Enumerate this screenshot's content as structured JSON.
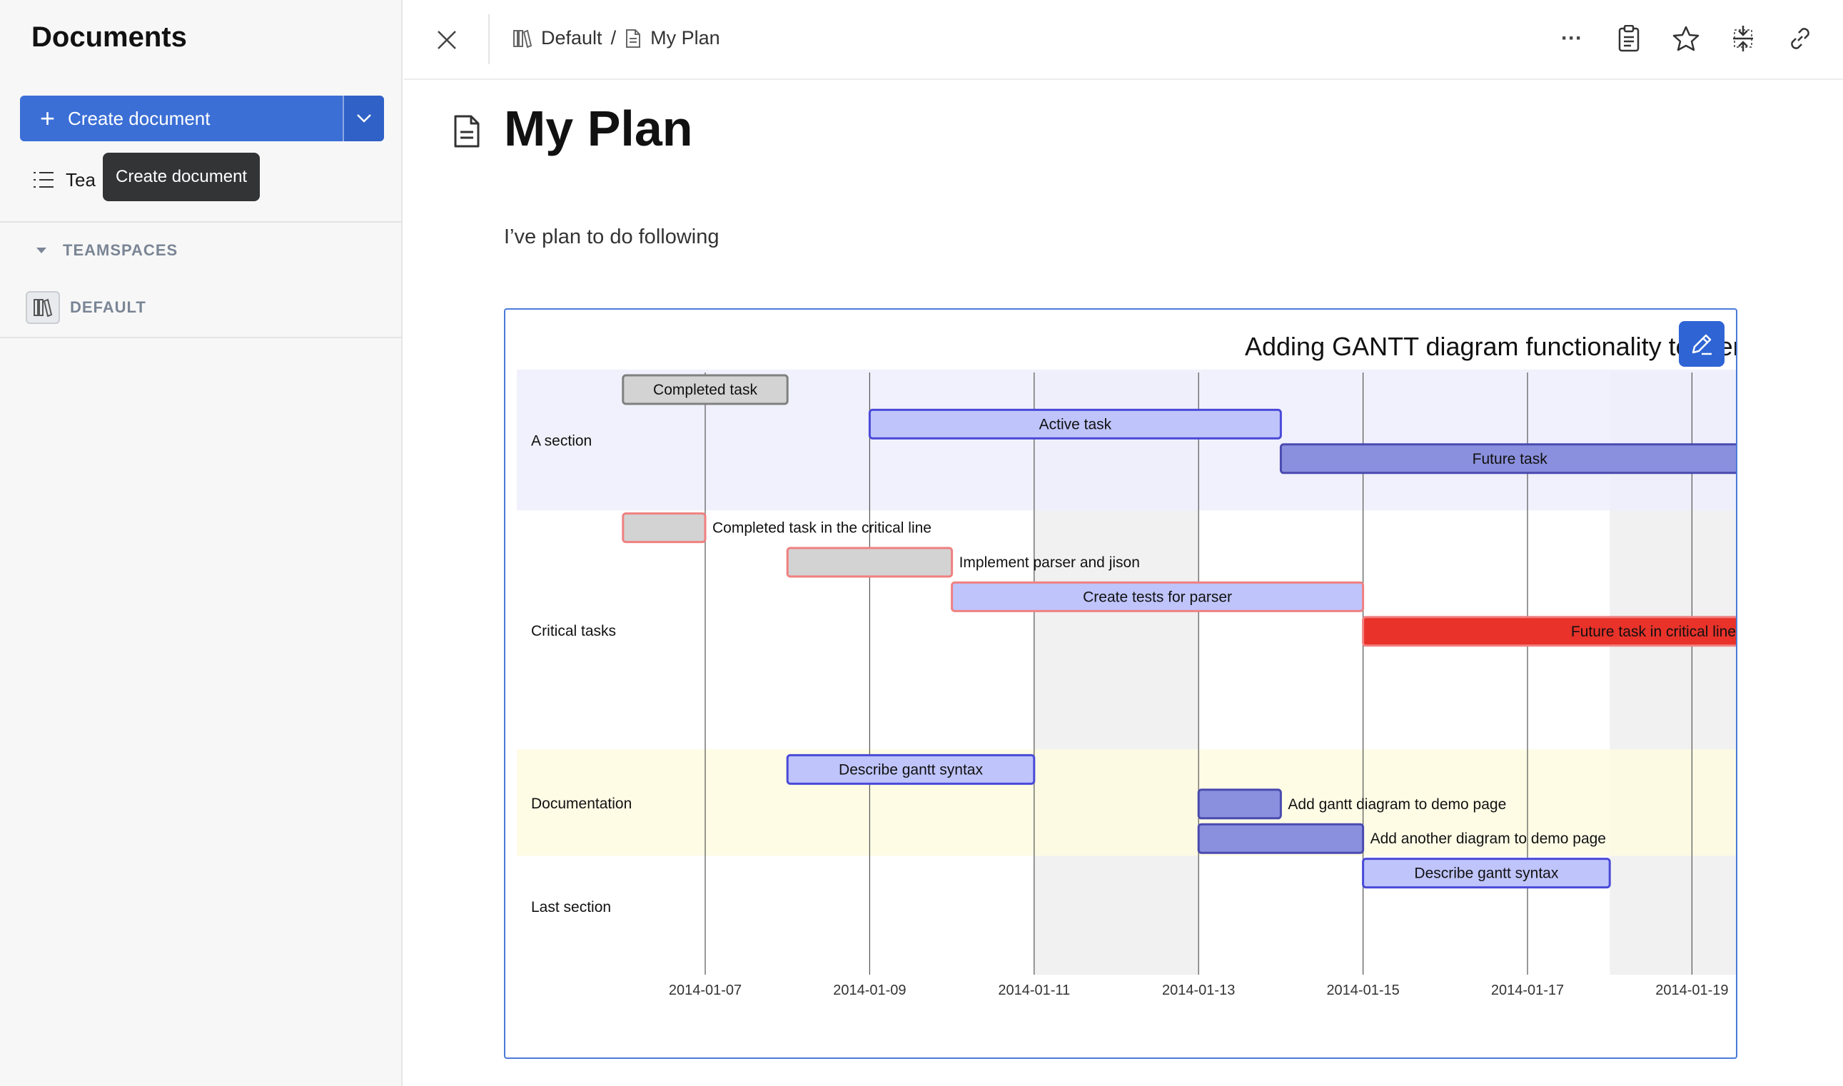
{
  "sidebar": {
    "title": "Documents",
    "create_label": "Create document",
    "templates_label": "Tea",
    "tooltip": "Create document",
    "teamspaces_header": "TEAMSPACES",
    "teamspace_name": "DEFAULT"
  },
  "header": {
    "breadcrumb_space": "Default",
    "breadcrumb_sep": "/",
    "breadcrumb_doc": "My Plan",
    "more_glyph": "···"
  },
  "document": {
    "title": "My Plan",
    "paragraph": "I’ve plan to do following"
  },
  "colors": {
    "accent": "#3b6fd6",
    "done": "#d3d3d3",
    "active": "#bfc4fb",
    "future": "#8a90dd",
    "critical": "#e8322a",
    "crit_border": "#f08080",
    "section_a": "#efeffd",
    "section_doc": "#fefce0"
  },
  "chart_data": {
    "type": "gantt",
    "title": "Adding GANTT diagram functionality to mermaid",
    "x_ticks": [
      "2014-01-07",
      "2014-01-09",
      "2014-01-11",
      "2014-01-13",
      "2014-01-15",
      "2014-01-17",
      "2014-01-19"
    ],
    "x_range": [
      "2014-01-06",
      "2014-01-19"
    ],
    "weekends": [
      [
        "2014-01-11",
        "2014-01-13"
      ],
      [
        "2014-01-18",
        "2014-01-20"
      ]
    ],
    "sections": [
      {
        "name": "A section",
        "start_row": 0,
        "end_row": 3
      },
      {
        "name": "Critical tasks",
        "start_row": 4,
        "end_row": 10
      },
      {
        "name": "Documentation",
        "start_row": 11,
        "end_row": 13
      },
      {
        "name": "Last section",
        "start_row": 14,
        "end_row": 16
      }
    ],
    "tasks": [
      {
        "label": "Completed task",
        "start": "2014-01-06",
        "end": "2014-01-08",
        "status": "done",
        "row": 0,
        "label_pos": "inside"
      },
      {
        "label": "Active task",
        "start": "2014-01-09",
        "end": "2014-01-14",
        "status": "active",
        "row": 1,
        "label_pos": "inside"
      },
      {
        "label": "Future task",
        "start": "2014-01-14",
        "end": "2014-01-20",
        "status": "future",
        "row": 2,
        "label_pos": "inside"
      },
      {
        "label": "Completed task in the critical line",
        "start": "2014-01-06",
        "end": "2014-01-07",
        "status": "crit-done",
        "row": 4,
        "label_pos": "outside"
      },
      {
        "label": "Implement parser and jison",
        "start": "2014-01-08",
        "end": "2014-01-10",
        "status": "crit-done",
        "row": 5,
        "label_pos": "outside"
      },
      {
        "label": "Create tests for parser",
        "start": "2014-01-10",
        "end": "2014-01-15",
        "status": "crit-active",
        "row": 6,
        "label_pos": "inside"
      },
      {
        "label": "Future task in critical line",
        "start": "2014-01-15",
        "end": "2014-01-20",
        "status": "crit-future",
        "row": 7,
        "label_pos": "inside-end"
      },
      {
        "label": "Describe gantt syntax",
        "start": "2014-01-08",
        "end": "2014-01-11",
        "status": "active",
        "row": 11,
        "label_pos": "inside"
      },
      {
        "label": "Add gantt diagram to demo page",
        "start": "2014-01-13",
        "end": "2014-01-14",
        "status": "future",
        "row": 12,
        "label_pos": "outside"
      },
      {
        "label": "Add another diagram to demo page",
        "start": "2014-01-13",
        "end": "2014-01-15",
        "status": "future",
        "row": 13,
        "label_pos": "outside"
      },
      {
        "label": "Describe gantt syntax",
        "start": "2014-01-15",
        "end": "2014-01-18",
        "status": "active",
        "row": 14,
        "label_pos": "inside"
      }
    ]
  }
}
